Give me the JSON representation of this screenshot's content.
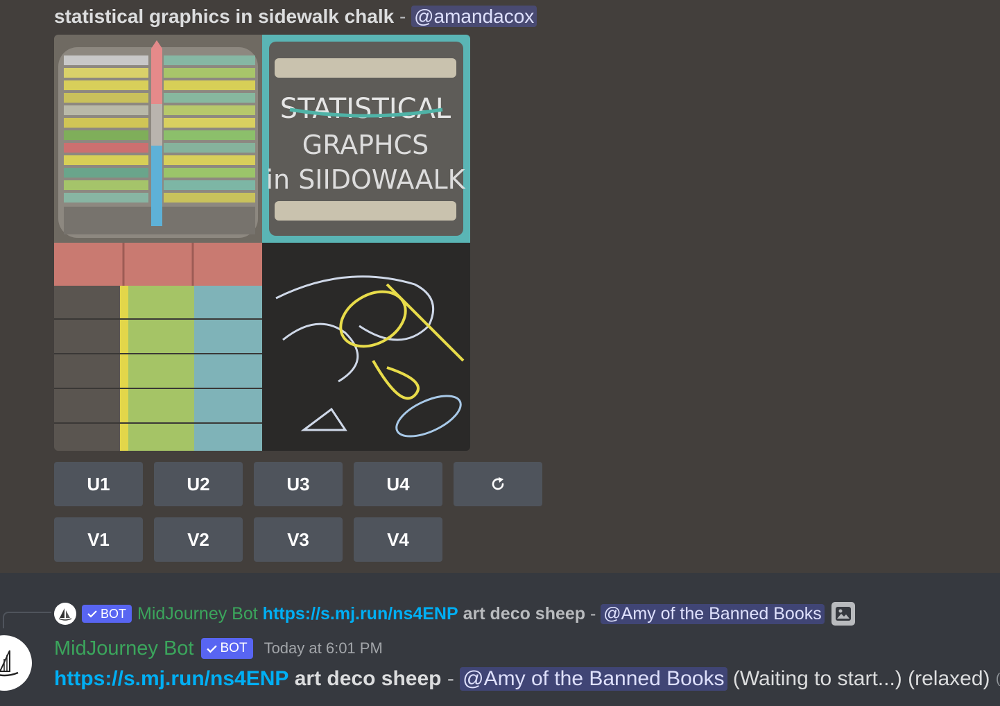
{
  "prompt_message": {
    "prompt_text": "statistical graphics in sidewalk chalk",
    "separator": "-",
    "mention": "@amandacox"
  },
  "image_grid": {
    "tile_top_right_text": [
      "STATISTICAL",
      "GRAPHCS",
      "in SIIDOWAALK"
    ]
  },
  "buttons": {
    "upscale": [
      "U1",
      "U2",
      "U3",
      "U4"
    ],
    "variation": [
      "V1",
      "V2",
      "V3",
      "V4"
    ],
    "reroll_icon": "refresh-icon"
  },
  "reply_preview": {
    "bot_tag": "BOT",
    "author": "MidJourney Bot",
    "link": "https://s.mj.run/ns4ENP",
    "prompt": "art deco sheep",
    "separator": "-",
    "mention": "@Amy of the Banned Books",
    "attachment_icon": "image-icon"
  },
  "message": {
    "author": "MidJourney Bot",
    "bot_tag": "BOT",
    "timestamp": "Today at 6:01 PM",
    "link": "https://s.mj.run/ns4ENP",
    "prompt": "art deco sheep",
    "separator": "-",
    "mention": "@Amy of the Banned Books",
    "status": "(Waiting to start...) (relaxed)",
    "cut_text": "(e"
  },
  "colors": {
    "bot_name": "#3ba55c",
    "bot_tag": "#5865f2",
    "link": "#00aff4",
    "button": "#4f545c"
  }
}
